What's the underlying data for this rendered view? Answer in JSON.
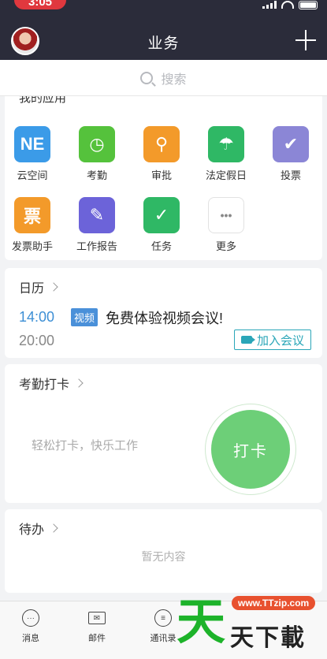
{
  "status_bar": {
    "time": "3:05"
  },
  "header": {
    "title": "业务"
  },
  "search": {
    "placeholder": "搜索"
  },
  "apps_section": {
    "title": "我的应用",
    "items": [
      {
        "label": "云空间",
        "icon": "cloud-space-icon",
        "color": "#3b9be8",
        "glyph": "NE"
      },
      {
        "label": "考勤",
        "icon": "attendance-icon",
        "color": "#55c23c",
        "glyph": "◷"
      },
      {
        "label": "审批",
        "icon": "approval-icon",
        "color": "#f39a2a",
        "glyph": "⚲"
      },
      {
        "label": "法定假日",
        "icon": "holiday-icon",
        "color": "#2fb865",
        "glyph": "☂"
      },
      {
        "label": "投票",
        "icon": "vote-icon",
        "color": "#8b86d6",
        "glyph": "✔"
      },
      {
        "label": "发票助手",
        "icon": "invoice-icon",
        "color": "#f39a2a",
        "glyph": "票"
      },
      {
        "label": "工作报告",
        "icon": "report-icon",
        "color": "#6c63d9",
        "glyph": "✎"
      },
      {
        "label": "任务",
        "icon": "task-icon",
        "color": "#2fb865",
        "glyph": "✓"
      },
      {
        "label": "更多",
        "icon": "more-icon",
        "color": "#ffffff",
        "glyph": "•••"
      }
    ]
  },
  "calendar": {
    "title": "日历",
    "event": {
      "start": "14:00",
      "end": "20:00",
      "badge": "视频",
      "title": "免费体验视频会议!",
      "join_label": "加入会议"
    }
  },
  "punch": {
    "title": "考勤打卡",
    "hint": "轻松打卡，快乐工作",
    "button": "打卡"
  },
  "todo": {
    "title": "待办",
    "empty": "暂无内容"
  },
  "tabbar": [
    {
      "label": "消息",
      "icon": "message-icon"
    },
    {
      "label": "邮件",
      "icon": "mail-icon"
    },
    {
      "label": "通讯录",
      "icon": "contacts-icon"
    }
  ],
  "watermark": {
    "big": "天",
    "url": "www.TTzip.com",
    "text": "天下載"
  }
}
